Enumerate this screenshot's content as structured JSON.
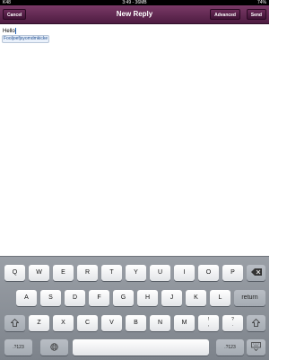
{
  "status": {
    "carrier": "K48",
    "time": "3:49 - 36MB",
    "battery": "74%"
  },
  "navbar": {
    "title": "New Reply",
    "cancel_label": "Cancel",
    "advanced_label": "Advanced",
    "send_label": "Send"
  },
  "compose": {
    "text": "Hello",
    "suggestion": "Fooljoefjsyomdmkicke"
  },
  "keyboard": {
    "row1": [
      "Q",
      "W",
      "E",
      "R",
      "T",
      "Y",
      "U",
      "I",
      "O",
      "P"
    ],
    "row2": [
      "A",
      "S",
      "D",
      "F",
      "G",
      "H",
      "J",
      "K",
      "L"
    ],
    "row3": [
      "Z",
      "X",
      "C",
      "V",
      "B",
      "N",
      "M"
    ],
    "return_label": "return",
    "num_label": ".?123",
    "punct1_top": "!",
    "punct1_bottom": ",",
    "punct2_top": "?",
    "punct2_bottom": ".",
    "backspace_icon": "backspace-icon",
    "shift_icon": "shift-icon",
    "globe_icon": "globe-icon",
    "hide_icon": "keyboard-hide-icon"
  }
}
